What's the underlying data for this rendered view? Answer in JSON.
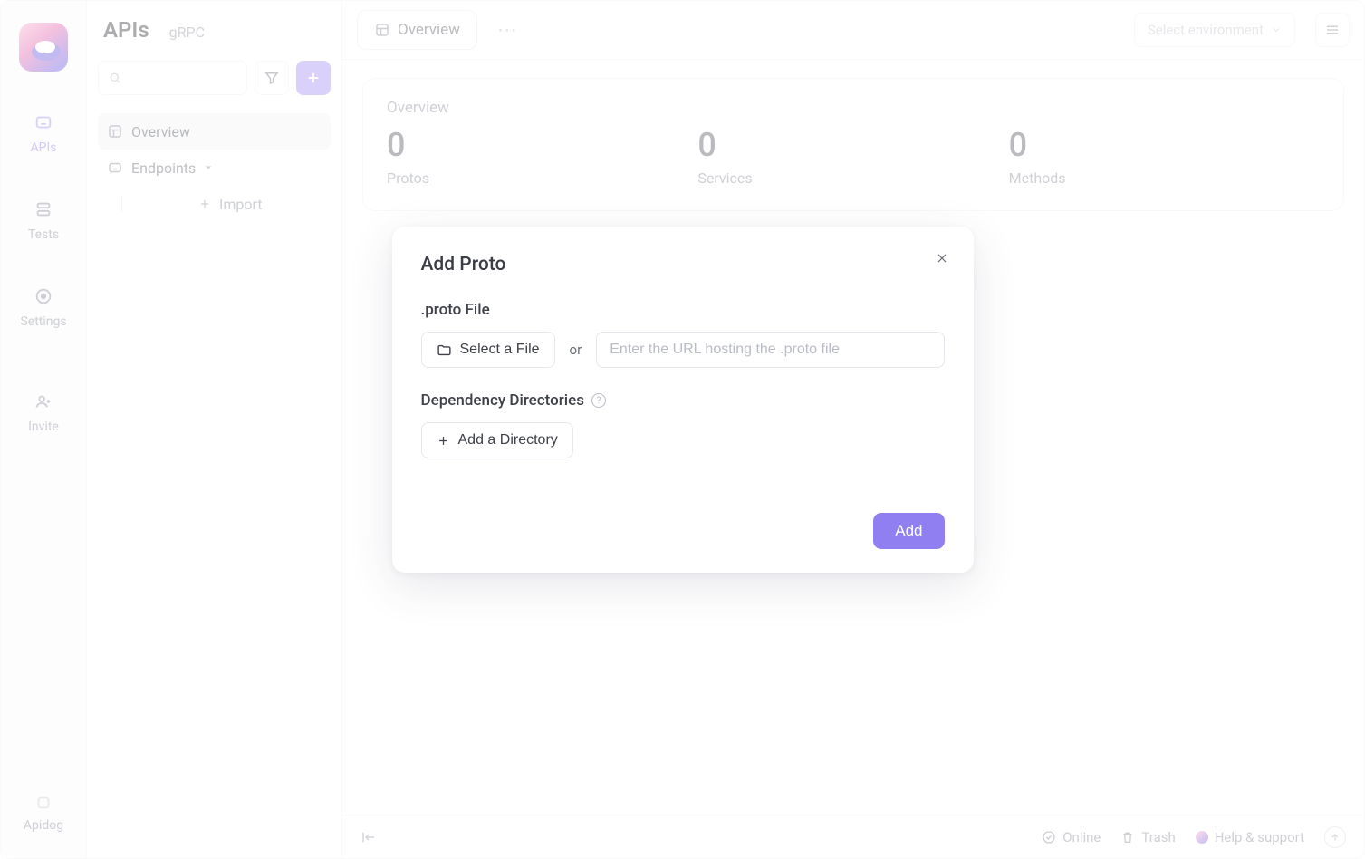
{
  "rail": {
    "items": [
      {
        "label": "APIs"
      },
      {
        "label": "Tests"
      },
      {
        "label": "Settings"
      }
    ],
    "invite": "Invite",
    "apidog": "Apidog"
  },
  "sidebar": {
    "title": "APIs",
    "protocol": "gRPC",
    "overview": "Overview",
    "endpoints": "Endpoints",
    "import": "Import"
  },
  "tabbar": {
    "overview_tab": "Overview",
    "env_placeholder": "Select environment"
  },
  "panel": {
    "title": "Overview",
    "stats": [
      {
        "value": "0",
        "label": "Protos"
      },
      {
        "value": "0",
        "label": "Services"
      },
      {
        "value": "0",
        "label": "Methods"
      }
    ]
  },
  "footer": {
    "online": "Online",
    "trash": "Trash",
    "help": "Help & support"
  },
  "modal": {
    "title": "Add Proto",
    "section_file": ".proto File",
    "select_file": "Select a File",
    "or": "or",
    "url_placeholder": "Enter the URL hosting the .proto file",
    "section_dep": "Dependency Directories",
    "add_dir": "Add a Directory",
    "add": "Add"
  }
}
